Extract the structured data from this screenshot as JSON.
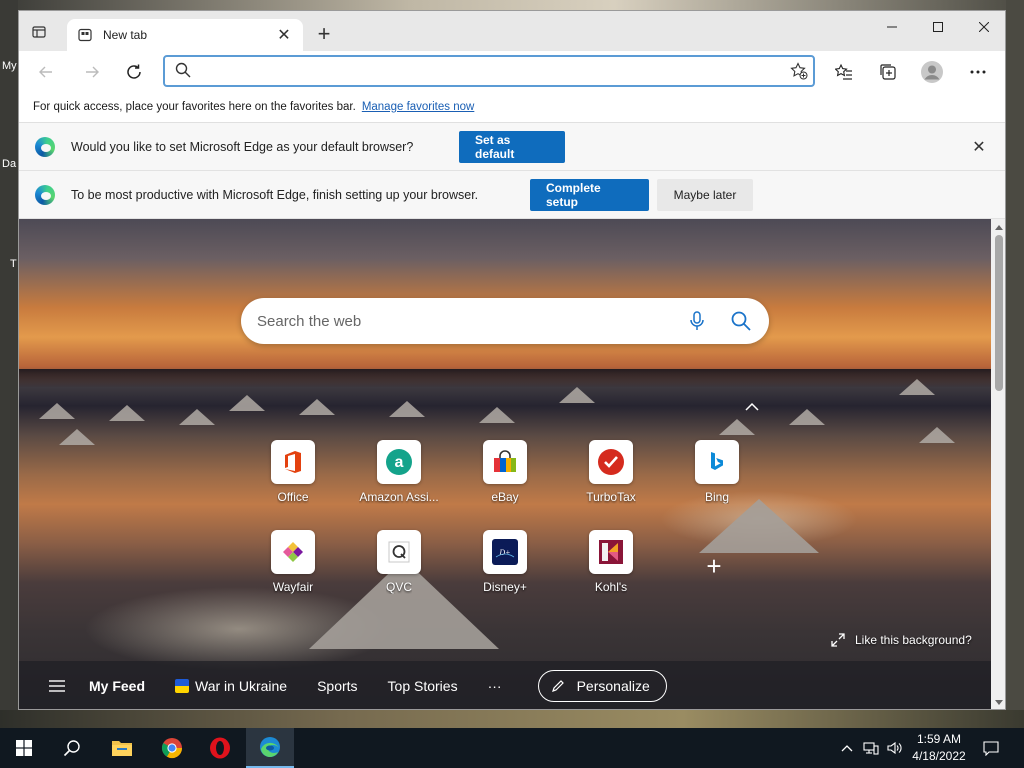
{
  "desktop": {
    "icon_label_1": "My",
    "icon_label_2": "Da",
    "icon_label_3": "T"
  },
  "browser": {
    "tab": {
      "title": "New tab"
    },
    "address": {
      "placeholder": "",
      "value": ""
    },
    "favorites_bar": {
      "text": "For quick access, place your favorites here on the favorites bar.",
      "link": "Manage favorites now"
    },
    "default_prompt": {
      "text": "Would you like to set Microsoft Edge as your default browser?",
      "button": "Set as default"
    },
    "setup_prompt": {
      "text": "To be most productive with Microsoft Edge, finish setting up your browser.",
      "primary_button": "Complete setup",
      "secondary_button": "Maybe later"
    }
  },
  "new_tab_page": {
    "search_placeholder": "Search the web",
    "tiles": [
      {
        "label": "Office",
        "icon": "office-icon",
        "color": "#e3410f"
      },
      {
        "label": "Amazon Assi...",
        "icon": "amazon-assistant-icon",
        "color": "#14a38b"
      },
      {
        "label": "eBay",
        "icon": "ebay-icon",
        "color": "#0064d2"
      },
      {
        "label": "TurboTax",
        "icon": "turbotax-icon",
        "color": "#d52b1e"
      },
      {
        "label": "Bing",
        "icon": "bing-icon",
        "color": "#0c8484"
      },
      {
        "label": "Wayfair",
        "icon": "wayfair-icon",
        "color": "#7b189f"
      },
      {
        "label": "QVC",
        "icon": "qvc-icon",
        "color": "#333333"
      },
      {
        "label": "Disney+",
        "icon": "disney-plus-icon",
        "color": "#0b1b57"
      },
      {
        "label": "Kohl's",
        "icon": "kohls-icon",
        "color": "#8a1538"
      }
    ],
    "like_background": "Like this background?",
    "feed": {
      "items": [
        "My Feed",
        "War in Ukraine",
        "Sports",
        "Top Stories"
      ],
      "more": "···",
      "personalize": "Personalize"
    }
  },
  "taskbar": {
    "apps": [
      "start-icon",
      "search-icon",
      "file-explorer-icon",
      "chrome-icon",
      "opera-icon",
      "edge-icon"
    ],
    "time": "1:59 AM",
    "date": "4/18/2022"
  },
  "colors": {
    "accent": "#0f6cbd",
    "taskbar": "#101820",
    "address_focus": "#5b9bd5"
  }
}
